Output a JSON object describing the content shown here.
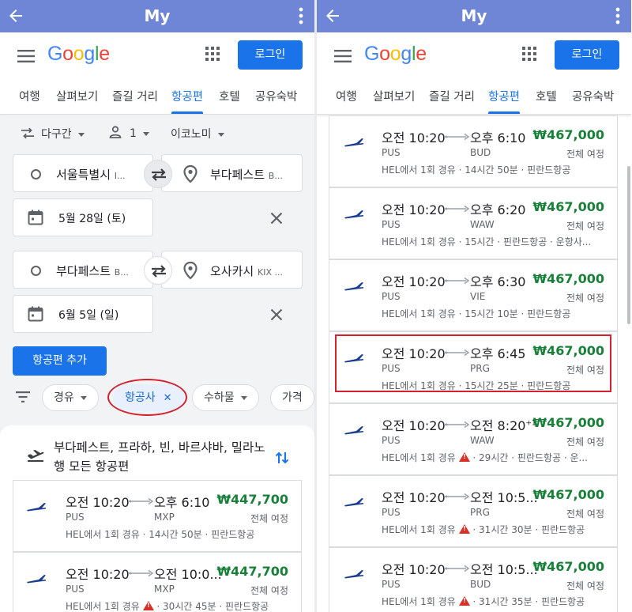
{
  "app": {
    "title": "My"
  },
  "header": {
    "logo": "Google",
    "login": "로그인"
  },
  "tabs": [
    "여행",
    "살펴보기",
    "즐길 거리",
    "항공편",
    "호텔",
    "공유숙박"
  ],
  "search": {
    "trip_type": "다구간",
    "passengers": "1",
    "cabin": "이코노미",
    "leg1": {
      "from": "서울특별시",
      "from_code": "I...",
      "to": "부다페스트",
      "to_code": "B...",
      "date": "5월 28일 (토)"
    },
    "leg2": {
      "from": "부다페스트",
      "from_code": "B...",
      "to": "오사카시",
      "to_code": "KIX ...",
      "date": "6월 5일 (일)"
    },
    "add_flight": "항공편 추가"
  },
  "filters": [
    "경유",
    "항공사",
    "수하물",
    "가격"
  ],
  "results_title": "부다페스트, 프라하, 빈, 바르샤바, 밀라노행 모든 항공편",
  "left_flights": [
    {
      "dep": "오전 10:20",
      "arr": "오후 6:10",
      "arr_sup": "",
      "price": "₩447,700",
      "from": "PUS",
      "to": "MXP",
      "trip": "전체 여정",
      "stop": "HEL에서 1회 경유",
      "warn": false,
      "duration": "14시간 50분",
      "airline": "핀란드항공"
    },
    {
      "dep": "오전 10:20",
      "arr": "오전 10:0...",
      "arr_sup": "",
      "price": "₩447,700",
      "from": "PUS",
      "to": "MXP",
      "trip": "전체 여정",
      "stop": "HEL에서 1회 경유",
      "warn": true,
      "duration": "30시간 45분",
      "airline": "핀란드항공"
    }
  ],
  "right_flights": [
    {
      "dep": "오전 10:20",
      "arr": "오후 6:10",
      "arr_sup": "",
      "price": "₩467,000",
      "from": "PUS",
      "to": "BUD",
      "trip": "전체 여정",
      "stop": "HEL에서 1회 경유",
      "warn": false,
      "duration": "14시간 50분",
      "airline": "핀란드항공"
    },
    {
      "dep": "오전 10:20",
      "arr": "오후 6:20",
      "arr_sup": "",
      "price": "₩467,000",
      "from": "PUS",
      "to": "WAW",
      "trip": "전체 여정",
      "stop": "HEL에서 1회 경유",
      "warn": false,
      "duration": "15시간",
      "airline": "핀란드항공 · 운항사..."
    },
    {
      "dep": "오전 10:20",
      "arr": "오후 6:30",
      "arr_sup": "",
      "price": "₩467,000",
      "from": "PUS",
      "to": "VIE",
      "trip": "전체 여정",
      "stop": "HEL에서 1회 경유",
      "warn": false,
      "duration": "15시간 10분",
      "airline": "핀란드항공"
    },
    {
      "dep": "오전 10:20",
      "arr": "오후 6:45",
      "arr_sup": "",
      "price": "₩467,000",
      "from": "PUS",
      "to": "PRG",
      "trip": "전체 여정",
      "stop": "HEL에서 1회 경유",
      "warn": false,
      "duration": "15시간 25분",
      "airline": "핀란드항공"
    },
    {
      "dep": "오전 10:20",
      "arr": "오전 8:20",
      "arr_sup": "+1",
      "price": "₩467,000",
      "from": "PUS",
      "to": "WAW",
      "trip": "전체 여정",
      "stop": "HEL에서 1회 경유",
      "warn": true,
      "duration": "29시간",
      "airline": "핀란드항공 · 운..."
    },
    {
      "dep": "오전 10:20",
      "arr": "오전 10:5...",
      "arr_sup": "",
      "price": "₩467,000",
      "from": "PUS",
      "to": "PRG",
      "trip": "전체 여정",
      "stop": "HEL에서 1회 경유",
      "warn": true,
      "duration": "31시간 30분",
      "airline": "핀란드항공"
    },
    {
      "dep": "오전 10:20",
      "arr": "오전 10:5...",
      "arr_sup": "",
      "price": "₩467,000",
      "from": "PUS",
      "to": "BUD",
      "trip": "전체 여정",
      "stop": "HEL에서 1회 경유",
      "warn": true,
      "duration": "31시간 35분",
      "airline": "핀란드항공"
    }
  ],
  "colors": {
    "appbar": "#6f86d6",
    "accent": "#1a73e8",
    "price": "#188038",
    "highlight": "#d3212f"
  }
}
